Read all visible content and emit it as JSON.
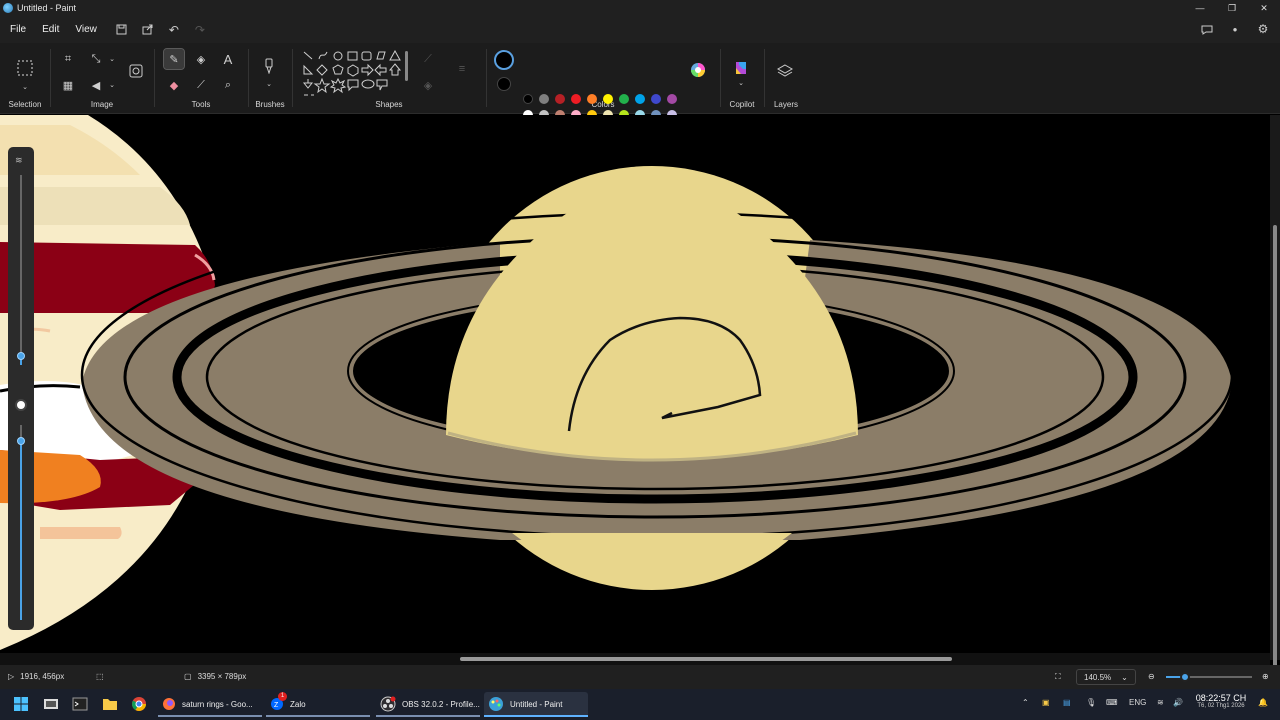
{
  "window": {
    "title": "Untitled - Paint"
  },
  "menu": {
    "file": "File",
    "edit": "Edit",
    "view": "View"
  },
  "ribbon": {
    "selection_label": "Selection",
    "image_label": "Image",
    "tools_label": "Tools",
    "brushes_label": "Brushes",
    "shapes_label": "Shapes",
    "colors_label": "Colors",
    "copilot_label": "Copilot",
    "layers_label": "Layers",
    "active_tool": "pencil",
    "primary_color": "#000000",
    "secondary_color": "#000000",
    "palette": [
      [
        "#000000",
        "#7f7f7f",
        "#b52025",
        "#ee1c24",
        "#ff7f27",
        "#fff200",
        "#22b14c",
        "#00a2e8",
        "#3f48cc",
        "#a349a4"
      ],
      [
        "#ffffff",
        "#c3c3c3",
        "#c08070",
        "#ffaec9",
        "#ffc90e",
        "#efe4b0",
        "#b5e61d",
        "#99d9ea",
        "#7092be",
        "#c8bfe7"
      ],
      [
        "#9c1c1c",
        "#4a7abf",
        "#a0c4f0",
        "#c8c8c8",
        "#f5e6a0",
        "#8a8a7a",
        "#d8c890",
        "",
        "",
        ""
      ]
    ]
  },
  "status": {
    "cursor_position": "1916, 456px",
    "canvas_size": "3395 × 789px",
    "zoom": "140.5%",
    "zoom_fraction": 0.22
  },
  "brush_size": {
    "fraction": 0.05,
    "opacity_fraction": 0.92
  },
  "taskbar": {
    "apps": [
      {
        "label": "saturn rings - Goo...",
        "icon": "firefox-icon"
      },
      {
        "label": "Zalo",
        "icon": "zalo-icon",
        "badge": "1"
      },
      {
        "label": "OBS 32.0.2 - Profile...",
        "icon": "obs-icon"
      },
      {
        "label": "Untitled - Paint",
        "icon": "paint-icon"
      }
    ],
    "language": "ENG",
    "time": "08:22:57 CH",
    "date": "T6, 02 Thg1 2026"
  },
  "colors": {
    "saturn_body": "#e8d68c",
    "rings": "#8b7d68",
    "jupiter_red": "#8b0015",
    "jupiter_orange": "#f08020",
    "jupiter_cream": "#f8ecc8",
    "accent": "#4aa3e8"
  }
}
